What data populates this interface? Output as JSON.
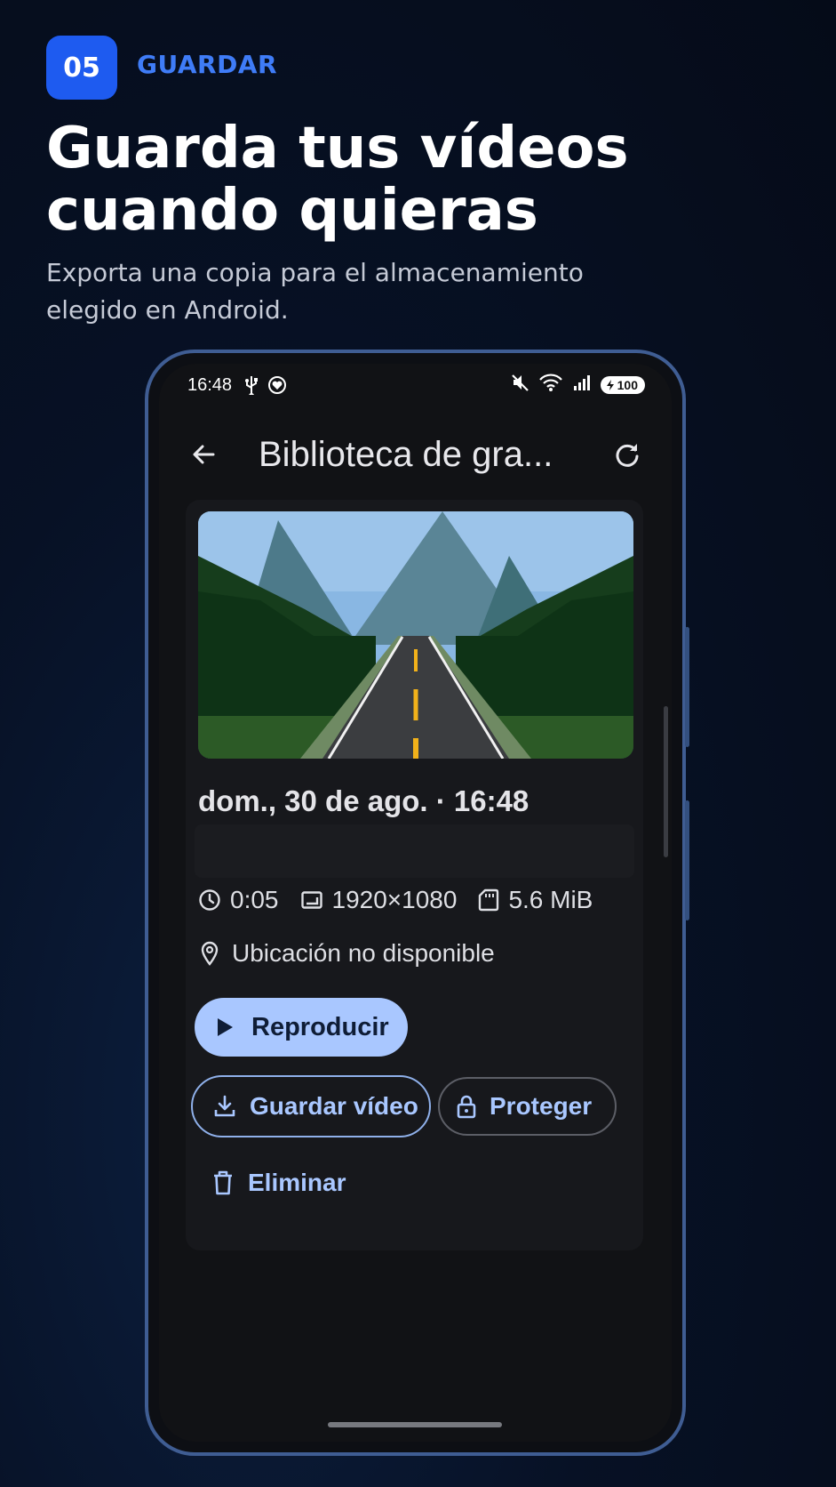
{
  "step": {
    "number": "05",
    "label": "GUARDAR"
  },
  "headline": {
    "line1": "Guarda tus vídeos",
    "line2": "cuando quieras"
  },
  "subtitle": {
    "line1": "Exporta una copia para el almacenamiento",
    "line2": "elegido en Android."
  },
  "colors": {
    "accent": "#1e5bf0",
    "accent_text": "#3f7cf7",
    "button_primary": "#a9c7ff",
    "frame": "#3f5d93"
  },
  "status_bar": {
    "time": "16:48",
    "left_icons": [
      "usb-icon",
      "vpn-heart-icon"
    ],
    "right_icons": [
      "mute-icon",
      "wifi-icon",
      "signal-icon"
    ],
    "battery": "100"
  },
  "app_bar": {
    "title": "Biblioteca de gra...",
    "back_icon": "arrow-left-icon",
    "refresh_icon": "refresh-icon"
  },
  "recording": {
    "date": "dom., 30 de ago. · 16:48",
    "duration": "0:05",
    "resolution": "1920×1080",
    "size": "5.6 MiB",
    "location": "Ubicación no disponible"
  },
  "actions": {
    "play": "Reproducir",
    "save": "Guardar vídeo",
    "protect": "Proteger",
    "delete": "Eliminar"
  }
}
